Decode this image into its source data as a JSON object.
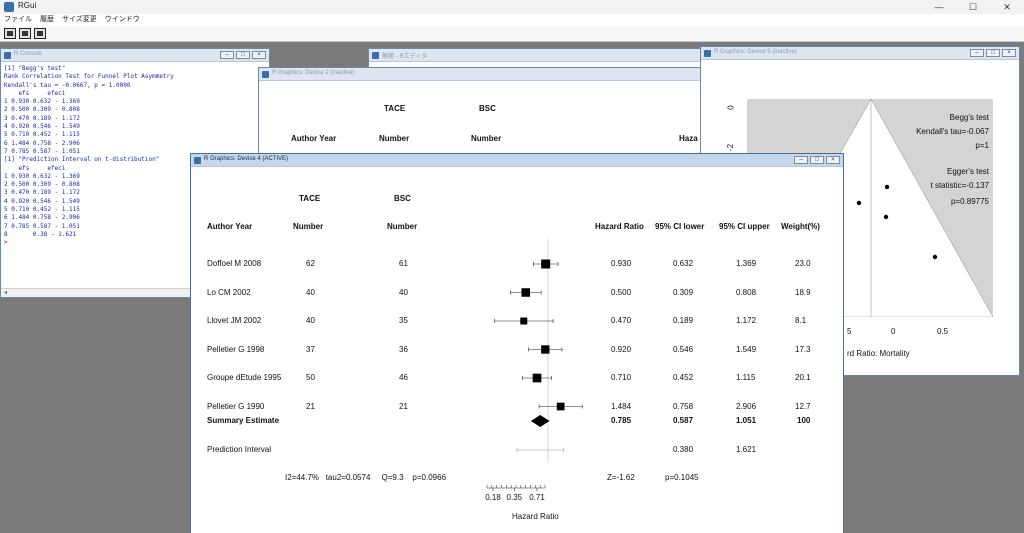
{
  "app": {
    "title": "RGui",
    "window_controls": [
      "—",
      "☐",
      "✕"
    ]
  },
  "menu": [
    "ファイル",
    "履歴",
    "サイズ変更",
    "ウインドウ"
  ],
  "console": {
    "title": "R Console",
    "lines": [
      "[1] \"Begg's test\"",
      "",
      "Rank Correlation Test for Funnel Plot Asymmetry",
      "",
      "Kendall's tau = -0.0667, p = 1.0000",
      "",
      "    efs     efeci",
      "1 0.930 0.632 - 1.369",
      "2 0.500 0.309 - 0.808",
      "3 0.470 0.189 - 1.172",
      "4 0.920 0.546 - 1.549",
      "5 0.710 0.452 - 1.115",
      "6 1.484 0.758 - 2.906",
      "7 0.785 0.587 - 1.051",
      "[1] \"Prediction Interval on t-distribution\"",
      "    efs     efeci",
      "1 0.930 0.632 - 1.369",
      "2 0.500 0.309 - 0.808",
      "3 0.470 0.189 - 1.172",
      "4 0.920 0.546 - 1.549",
      "5 0.710 0.452 - 1.115",
      "6 1.484 0.758 - 2.906",
      "7 0.785 0.587 - 1.051",
      "8       0.38 - 1.621"
    ],
    "prompt": ">",
    "scroll_left": "◂"
  },
  "editor": {
    "title": "無題 - Rエディタ"
  },
  "device2": {
    "title": "R Graphics: Device 2 (inactive)",
    "col_tace": "TACE",
    "col_bsc": "BSC",
    "author_year": "Author Year",
    "number1": "Number",
    "number2": "Number",
    "hazard_partial": "Haza"
  },
  "device5": {
    "title": "R Graphics: Device 5 (inactive)",
    "begg_title": "Begg's test",
    "begg_tau": "Kendall's tau=-0.067",
    "begg_p": "p=1",
    "egger_title": "Egger's test",
    "egger_t": "t statistic=-0.137",
    "egger_p": "p=0.89775",
    "x_ticks": [
      "5",
      "0",
      "0.5"
    ],
    "y_tick": "0",
    "y_tick2": "-2",
    "xlabel_partial": "rd Ratio: Mortality"
  },
  "device4": {
    "title": "R Graphics: Device 4 (ACTIVE)",
    "headers": {
      "tace": "TACE",
      "bsc": "BSC",
      "author": "Author Year",
      "number1": "Number",
      "number2": "Number",
      "hr": "Hazard Ratio",
      "lower": "95% CI lower",
      "upper": "95% CI upper",
      "weight": "Weight(%)"
    },
    "studies": [
      {
        "name": "Doffoel M 2008",
        "tace": "62",
        "bsc": "61",
        "hr": "0.930",
        "lower": "0.632",
        "upper": "1.369",
        "weight": "23.0"
      },
      {
        "name": "Lo CM 2002",
        "tace": "40",
        "bsc": "40",
        "hr": "0.500",
        "lower": "0.309",
        "upper": "0.808",
        "weight": "18.9"
      },
      {
        "name": "Llovet JM 2002",
        "tace": "40",
        "bsc": "35",
        "hr": "0.470",
        "lower": "0.189",
        "upper": "1.172",
        "weight": "8.1"
      },
      {
        "name": "Pelletier G 1998",
        "tace": "37",
        "bsc": "36",
        "hr": "0.920",
        "lower": "0.546",
        "upper": "1.549",
        "weight": "17.3"
      },
      {
        "name": "Groupe dEtude 1995",
        "tace": "50",
        "bsc": "46",
        "hr": "0.710",
        "lower": "0.452",
        "upper": "1.115",
        "weight": "20.1"
      },
      {
        "name": "Pelletier G 1990",
        "tace": "21",
        "bsc": "21",
        "hr": "1.484",
        "lower": "0.758",
        "upper": "2.906",
        "weight": "12.7"
      }
    ],
    "summary": {
      "name": "Summary Estimate",
      "hr": "0.785",
      "lower": "0.587",
      "upper": "1.051",
      "weight": "100"
    },
    "prediction": {
      "name": "Prediction Interval",
      "lower": "0.380",
      "upper": "1.621"
    },
    "het_stats": "I2=44.7%   tau2=0.0574     Q=9.3    p=0.0966",
    "z_stat": "Z=-1.62",
    "z_p": "p=0.1045",
    "x_ticks": [
      "0.18",
      "0.35",
      "0.71"
    ],
    "xlabel": "Hazard Ratio"
  },
  "chart_data": {
    "type": "forest",
    "title": "",
    "xlabel": "Hazard Ratio",
    "x_scale": "log",
    "x_ticks": [
      0.18,
      0.35,
      0.71
    ],
    "reference_line": 1,
    "studies": [
      {
        "name": "Doffoel M 2008",
        "hr": 0.93,
        "lower": 0.632,
        "upper": 1.369,
        "weight": 23.0
      },
      {
        "name": "Lo CM 2002",
        "hr": 0.5,
        "lower": 0.309,
        "upper": 0.808,
        "weight": 18.9
      },
      {
        "name": "Llovet JM 2002",
        "hr": 0.47,
        "lower": 0.189,
        "upper": 1.172,
        "weight": 8.1
      },
      {
        "name": "Pelletier G 1998",
        "hr": 0.92,
        "lower": 0.546,
        "upper": 1.549,
        "weight": 17.3
      },
      {
        "name": "Groupe dEtude 1995",
        "hr": 0.71,
        "lower": 0.452,
        "upper": 1.115,
        "weight": 20.1
      },
      {
        "name": "Pelletier G 1990",
        "hr": 1.484,
        "lower": 0.758,
        "upper": 2.906,
        "weight": 12.7
      }
    ],
    "summary": {
      "hr": 0.785,
      "lower": 0.587,
      "upper": 1.051
    },
    "prediction_interval": {
      "lower": 0.38,
      "upper": 1.621
    }
  }
}
